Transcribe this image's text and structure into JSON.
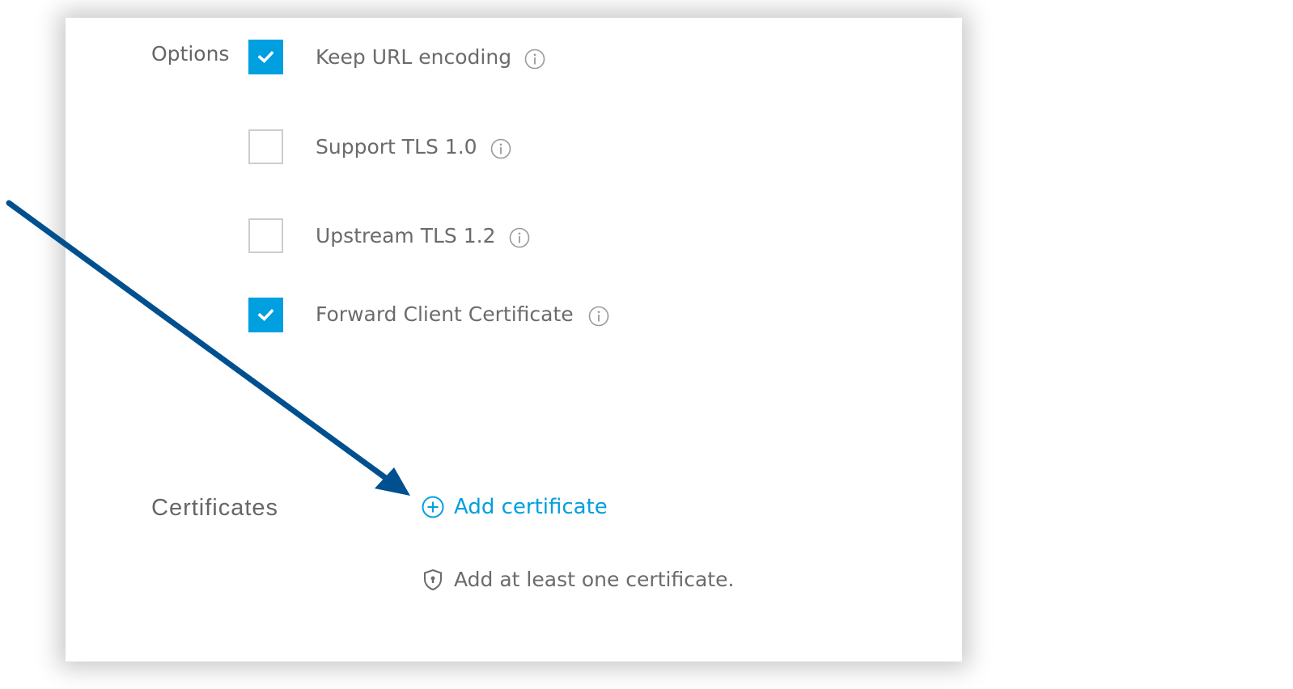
{
  "options": {
    "label": "Options",
    "items": [
      {
        "label": "Keep URL encoding",
        "checked": true,
        "info_icon": "info-icon"
      },
      {
        "label": "Support TLS 1.0",
        "checked": false,
        "info_icon": "info-icon"
      },
      {
        "label": "Upstream TLS 1.2",
        "checked": false,
        "info_icon": "info-icon"
      },
      {
        "label": "Forward Client Certificate",
        "checked": true,
        "info_icon": "info-icon"
      }
    ]
  },
  "certificates": {
    "label": "Certificates",
    "add_button_label": "Add certificate",
    "add_icon": "plus-circle-icon",
    "hint_icon": "shield-lock-icon",
    "hint_text": "Add at least one certificate."
  },
  "annotation": {
    "type": "arrow",
    "points_to": "add-certificate-button"
  },
  "colors": {
    "accent": "#009fe0",
    "annotation_arrow": "#00508f",
    "text": "#6b6b6b",
    "checkbox_border": "#cdcdcd"
  }
}
